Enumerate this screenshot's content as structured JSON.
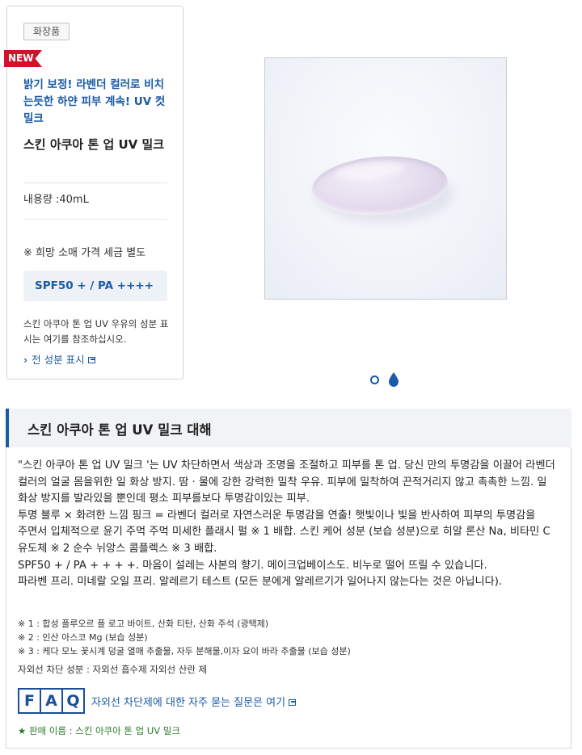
{
  "product": {
    "category": "화장품",
    "new_badge": "NEW",
    "tagline": "밝기 보정! 라벤더 컬러로 비치는듯한 하얀 피부 계속! UV 컷 밀크",
    "name": "스킨 아쿠아 톤 업 UV 밀크",
    "volume": "내용량 :40mL",
    "price_note": "※ 희망 소매 가격 세금 별도",
    "spf": "SPF50 + / PA ++++",
    "ingredient_note": "스킨 아쿠아 톤 업 UV 우유의 성분 표시는 여기를 참조하십시오.",
    "full_ingredients_link": "전 성분 표시"
  },
  "gallery": {
    "image": "lavender-milk-swatch",
    "pager": [
      "dot",
      "drop"
    ],
    "active_index": 1
  },
  "about": {
    "title": "스킨 아쿠아 톤 업 UV 밀크 대해",
    "description": [
      "\"스킨 아쿠아 톤 업 UV 밀크 '는 UV 차단하면서 색상과 조명을 조절하고 피부를 톤 업. 당신 만의 투명감을 이끌어 라벤더 컬러의 얼굴 몸을위한 일 화상 방지. 땀 · 물에 강한 강력한 밀착 우유. 피부에 밀착하여 끈적거리지 않고 촉촉한 느낌. 일 화상 방지를 발라있을 뿐인데 평소 피부를보다 투명감이있는 피부.",
      "투명 블루 × 화려한 느낌 핑크 = 라벤더 컬러로 자연스러운 투명감을 연출! 햇빛이나 빛을 반사하여 피부의 투명감을 주면서 입체적으로 윤기 주먹 주먹 미세한 플래시 펄 ※ 1 배합. 스킨 케어 성분 (보습 성분)으로 히알 론산 Na, 비타민 C 유도체 ※ 2 순수 뉘앙스 콤플렉스 ※ 3 배합.",
      "SPF50 + / PA + + + +. 마음이 설레는 사본의 향기. 메이크업베이스도. 비누로 떨어 뜨릴 수 있습니다.",
      "파라벤 프리. 미네랄 오일 프리. 알레르기 테스트 (모든 분에게 알레르기가 일어나지 않는다는 것은 아닙니다)."
    ],
    "footnotes": [
      "※ 1 : 합성 플루오르 플 로고 바이트, 산화 티탄, 산화 주석 (광택제)",
      "※ 2 : 인산 아스코 Mg (보습 성분)",
      "※ 3 : 케다 모노 꽃시계 덩굴 열매 추출물, 자두 분해물,이자 요이 바라 추출물 (보습 성분)"
    ],
    "uv_note": "자외선 차단 성분 : 자외선 흡수제 자외선 산란 제",
    "faq_letters": [
      "F",
      "A",
      "Q"
    ],
    "faq_link": "자외선 차단제에 대한 자주 묻는 질문은 여기",
    "sale_name": "★ 판매 이름 : 스킨 아쿠아 톤 업 UV 밀크"
  },
  "colors": {
    "accent_blue": "#1b5aa6",
    "new_red": "#d3112a",
    "sale_green": "#2c7a2c"
  }
}
